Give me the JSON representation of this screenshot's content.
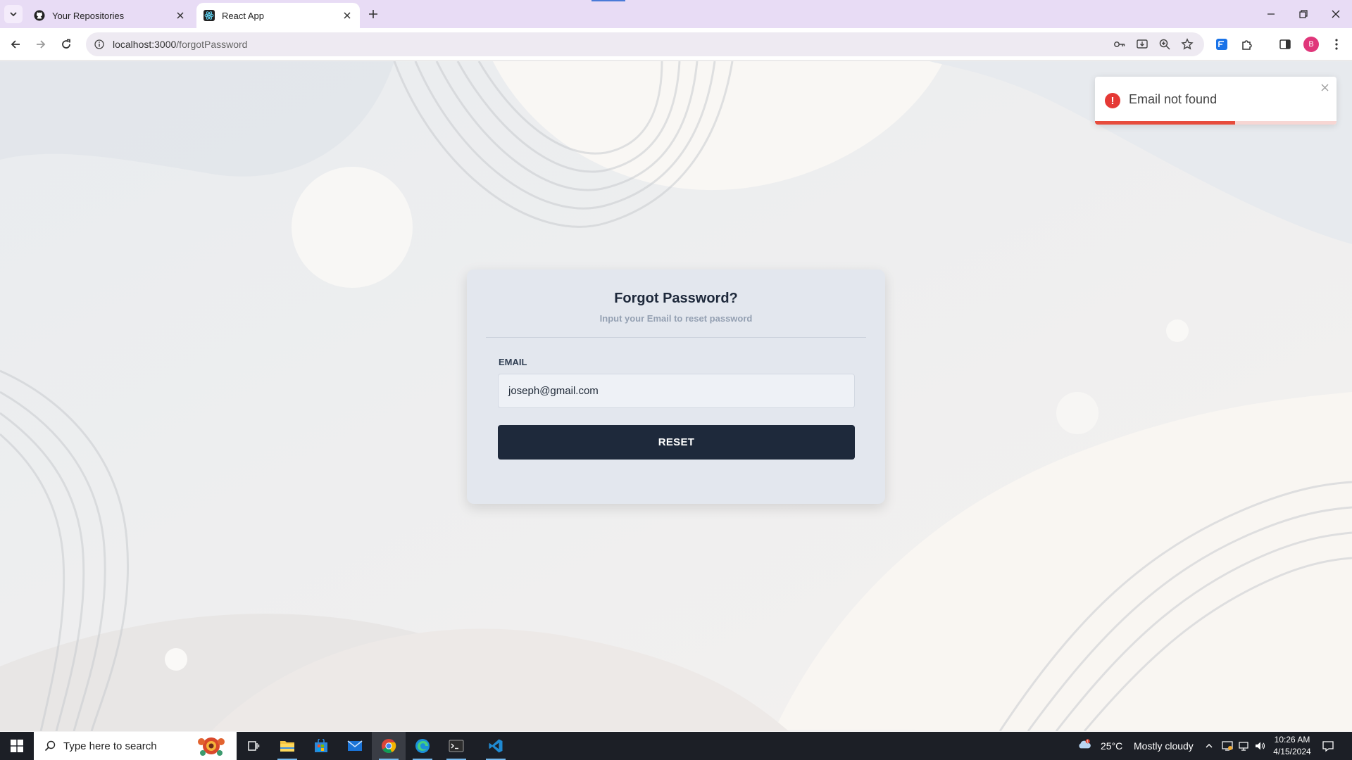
{
  "browser": {
    "tabs": [
      {
        "title": "Your Repositories",
        "favicon": "github-icon",
        "active": false
      },
      {
        "title": "React App",
        "favicon": "react-icon",
        "active": true
      }
    ],
    "address": {
      "host": "localhost:3000",
      "path": "/forgotPassword"
    },
    "profile_initial": "B"
  },
  "page": {
    "card": {
      "title": "Forgot Password?",
      "subtitle": "Input your Email to reset password",
      "email_label": "EMAIL",
      "email_value": "joseph@gmail.com",
      "reset_label": "RESET"
    },
    "toast": {
      "message": "Email not found",
      "type": "error",
      "progress_percent": 58,
      "accent_color": "#e74c3c"
    }
  },
  "taskbar": {
    "search_placeholder": "Type here to search",
    "apps": [
      "task-view-icon",
      "file-explorer-icon",
      "microsoft-store-icon",
      "mail-icon",
      "chrome-icon",
      "edge-icon",
      "terminal-icon",
      "vscode-icon"
    ],
    "weather": {
      "temperature": "25°C",
      "condition": "Mostly cloudy",
      "badge": "1"
    },
    "time": "10:26 AM",
    "date": "4/15/2024"
  },
  "colors": {
    "tab_strip": "#e8dcf5",
    "card_background": "#e3e7ee",
    "button_background": "#1e293b",
    "error": "#e53935"
  }
}
